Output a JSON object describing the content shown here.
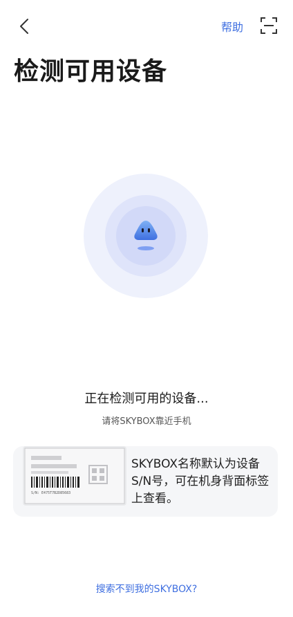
{
  "header": {
    "help_label": "帮助",
    "back_icon": "chevron-left-icon",
    "scan_icon": "scan-icon"
  },
  "page": {
    "title": "检测可用设备"
  },
  "detect": {
    "status": "正在检测可用的设备...",
    "hint": "请将SKYBOX靠近手机"
  },
  "info_card": {
    "description": "SKYBOX名称默认为设备S/N号，可在机身背面标签上查看。",
    "sn_text": "S/N: E475T7B2D85683"
  },
  "footer": {
    "link_label": "搜索不到我的SKYBOX?"
  },
  "colors": {
    "accent": "#3f6fe0",
    "ring_light": "#eef1fc",
    "ring_mid": "#dfe4fa",
    "ring_inner": "#d2d9f8"
  }
}
